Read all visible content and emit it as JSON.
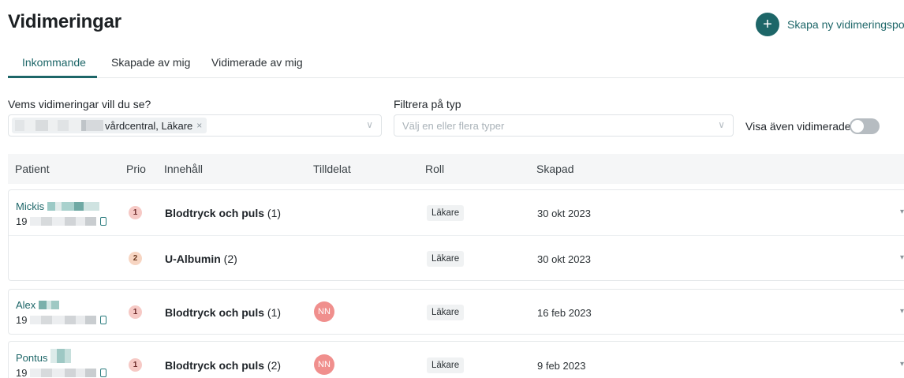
{
  "header": {
    "title": "Vidimeringar",
    "create_label": "Skapa ny vidimeringspost",
    "create_icon": "+"
  },
  "tabs": [
    {
      "label": "Inkommande",
      "active": true
    },
    {
      "label": "Skapade av mig",
      "active": false
    },
    {
      "label": "Vidimerade av mig",
      "active": false
    }
  ],
  "filters": {
    "whose_label": "Vems vidimeringar vill du se?",
    "whose_chip": "vårdcentral, Läkare",
    "whose_chip_remove": "×",
    "type_label": "Filtrera på typ",
    "type_placeholder": "Välj en eller flera typer",
    "chevron": "∨",
    "toggle_label": "Visa även vidimerade",
    "toggle_on": false
  },
  "table": {
    "columns": [
      "Patient",
      "Prio",
      "Innehåll",
      "Tilldelat",
      "Roll",
      "Skapad"
    ],
    "groups": [
      {
        "patient_first": "Mickis",
        "patient_id_prefix": "19",
        "rows": [
          {
            "prio": "1",
            "content_bold": "Blodtryck och puls",
            "content_count": "(1)",
            "assigned": "",
            "role": "Läkare",
            "created": "30 okt 2023"
          },
          {
            "prio": "2",
            "content_bold": "U-Albumin",
            "content_count": "(2)",
            "assigned": "",
            "role": "Läkare",
            "created": "30 okt 2023"
          }
        ]
      },
      {
        "patient_first": "Alex",
        "patient_id_prefix": "19",
        "rows": [
          {
            "prio": "1",
            "content_bold": "Blodtryck och puls",
            "content_count": "(1)",
            "assigned": "NN",
            "role": "Läkare",
            "created": "16 feb 2023"
          }
        ]
      },
      {
        "patient_first": "Pontus",
        "patient_id_prefix": "19",
        "rows": [
          {
            "prio": "1",
            "content_bold": "Blodtryck och puls",
            "content_count": "(2)",
            "assigned": "NN",
            "role": "Läkare",
            "created": "9 feb 2023"
          }
        ]
      }
    ],
    "expand_icon": "▾"
  },
  "colors": {
    "accent": "#1d6668",
    "prio1": "#f6c9c5",
    "prio2": "#f7d5c2",
    "avatar": "#f08f8d"
  }
}
